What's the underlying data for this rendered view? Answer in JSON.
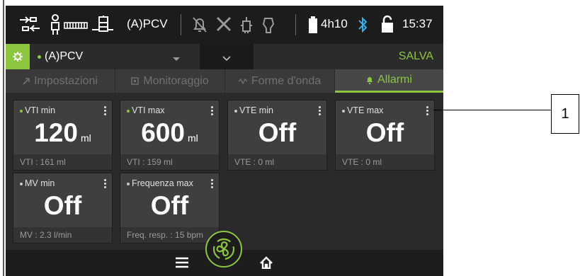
{
  "status_bar": {
    "icons": [
      "circuit-icon",
      "patient-icon",
      "humidifier-icon"
    ],
    "mode": "(A)PCV",
    "alarm_icons": [
      "alarm-off-icon",
      "tools-icon",
      "nebulizer-icon",
      "oxygen-icon"
    ],
    "battery_time": "4h10",
    "bluetooth": "bluetooth-icon",
    "lock": "lock-icon",
    "time": "15:37"
  },
  "mode_bar": {
    "mode_label": "(A)PCV",
    "save_label": "SALVA"
  },
  "tabs": [
    {
      "label": "Impostazioni",
      "icon": "settings-arrow-icon",
      "active": false
    },
    {
      "label": "Monitoraggio",
      "icon": "monitor-icon",
      "active": false
    },
    {
      "label": "Forme d'onda",
      "icon": "wave-icon",
      "active": false
    },
    {
      "label": "Allarmi",
      "icon": "bell-icon",
      "active": true
    }
  ],
  "alarm_cards": [
    {
      "title": "VTI min",
      "value": "120",
      "unit": "ml",
      "measured": "VTI : 161 ml",
      "dot": "green"
    },
    {
      "title": "VTI max",
      "value": "600",
      "unit": "ml",
      "measured": "VTI : 159 ml",
      "dot": "green"
    },
    {
      "title": "VTE min",
      "value": "Off",
      "unit": "",
      "measured": "VTE : 0 ml",
      "dot": "grey"
    },
    {
      "title": "VTE max",
      "value": "Off",
      "unit": "",
      "measured": "VTE : 0 ml",
      "dot": "grey"
    },
    {
      "title": "MV min",
      "value": "Off",
      "unit": "",
      "measured": "MV : 2.3 l/min",
      "dot": "grey"
    },
    {
      "title": "Frequenza max",
      "value": "Off",
      "unit": "",
      "measured": "Freq. resp. : 15 bpm",
      "dot": "grey"
    }
  ],
  "bottom_bar": {
    "icons": [
      "menu-icon",
      "fan-icon",
      "home-icon"
    ]
  },
  "callout": {
    "label": "1"
  },
  "colors": {
    "accent": "#8cc63f",
    "background": "#2a2a2a",
    "card": "#3f3f3f"
  }
}
